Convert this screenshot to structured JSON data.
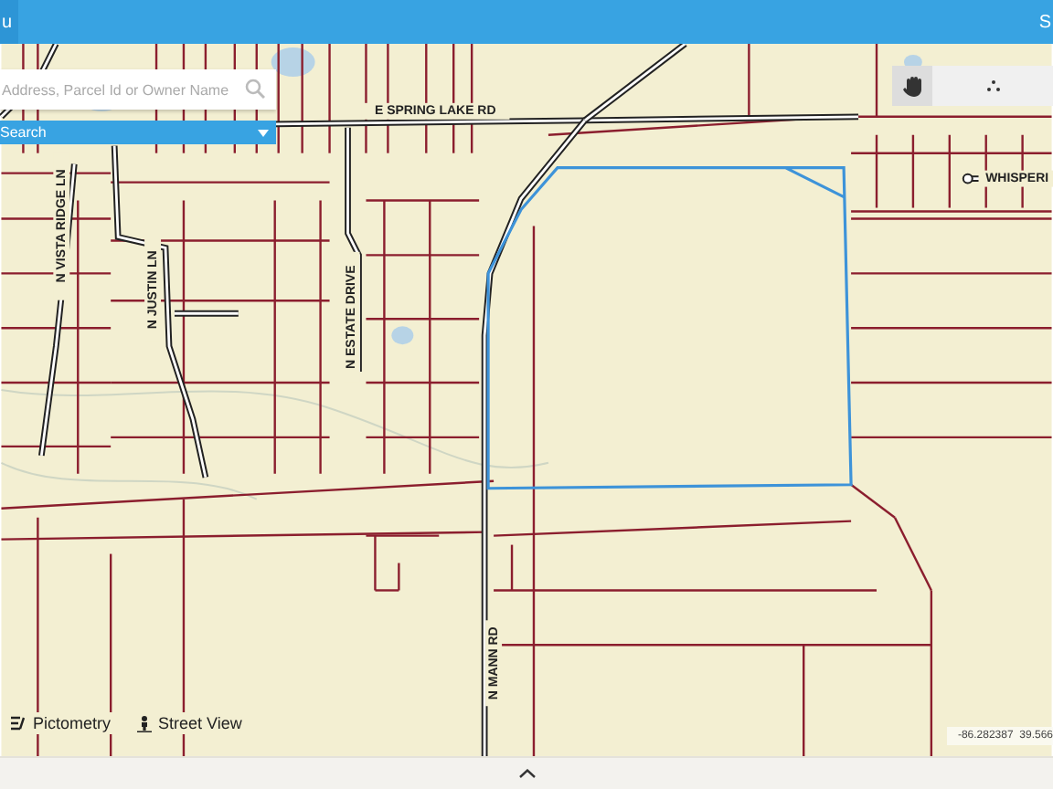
{
  "header": {
    "left_text": "u",
    "right_text": "S"
  },
  "search": {
    "placeholder": "Address, Parcel Id or Owner Name"
  },
  "search_mode": {
    "label": "Search"
  },
  "map": {
    "road_labels": [
      "E SPRING LAKE RD",
      "N VISTA RIDGE LN",
      "N JUSTIN LN",
      "N ESTATE DRIVE",
      "N MANN RD",
      "WHISPERI"
    ]
  },
  "tools": [
    {
      "kind": "pan",
      "selected": true
    },
    {
      "kind": "identify",
      "selected": false
    }
  ],
  "links": [
    {
      "kind": "pictometry",
      "label": "Pictometry"
    },
    {
      "kind": "street-view",
      "label": "Street View"
    }
  ],
  "coordinates": "-86.282387  39.566"
}
